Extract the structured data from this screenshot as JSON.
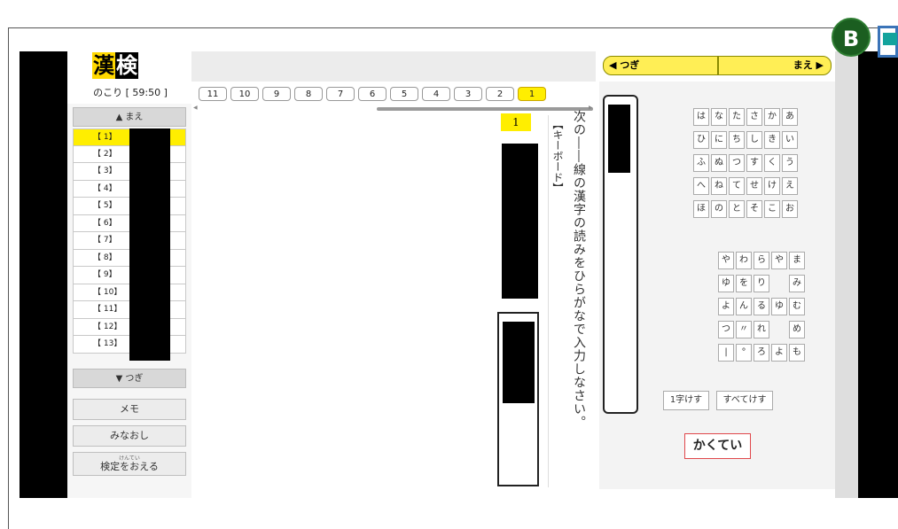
{
  "app": {
    "logo_char1": "漢",
    "logo_char2": "検",
    "timer": "のこり [ 59:50 ]"
  },
  "question_tabs": [
    "11",
    "10",
    "9",
    "8",
    "7",
    "6",
    "5",
    "4",
    "3",
    "2",
    "1"
  ],
  "active_tab": "1",
  "sidebar": {
    "prev_label": "▲ まえ",
    "next_label": "▼ つぎ",
    "items": [
      "【 1】",
      "【 2】",
      "【 3】",
      "【 4】",
      "【 5】",
      "【 6】",
      "【 7】",
      "【 8】",
      "【 9】",
      "【 10】",
      "【 11】",
      "【 12】",
      "【 13】"
    ],
    "memo_label": "メモ",
    "review_label": "みなおし",
    "finish_ruby": "けんてい",
    "finish_label": "検定をおえる"
  },
  "question": {
    "number": "1",
    "keyboard_label": "【キーボード】",
    "instruction": "次の――線の漢字の読みをひらがなで入力しなさい。"
  },
  "nav": {
    "next_label": "◀ つぎ",
    "prev_label": "まえ ▶"
  },
  "keyboard": {
    "rows_top": [
      [
        "は",
        "な",
        "た",
        "さ",
        "か",
        "あ"
      ],
      [
        "ひ",
        "に",
        "ち",
        "し",
        "き",
        "い"
      ],
      [
        "ふ",
        "ぬ",
        "つ",
        "す",
        "く",
        "う"
      ],
      [
        "へ",
        "ね",
        "て",
        "せ",
        "け",
        "え"
      ],
      [
        "ほ",
        "の",
        "と",
        "そ",
        "こ",
        "お"
      ]
    ],
    "rows_bottom": [
      [
        "や",
        "わ",
        "ら",
        "や",
        "ま"
      ],
      [
        "ゆ",
        "を",
        "り",
        "",
        "み"
      ],
      [
        "よ",
        "ん",
        "る",
        "ゆ",
        "む"
      ],
      [
        "つ",
        "〃",
        "れ",
        "",
        "め"
      ],
      [
        "|",
        "°",
        "ろ",
        "よ",
        "も"
      ]
    ],
    "delete_one": "1字けす",
    "delete_all": "すべてけす",
    "submit_label": "かくてい"
  },
  "badge": {
    "letter": "B"
  },
  "colors": {
    "highlight": "#ffee00",
    "submit_border": "#e0474b",
    "badge": "#1b5e20"
  }
}
